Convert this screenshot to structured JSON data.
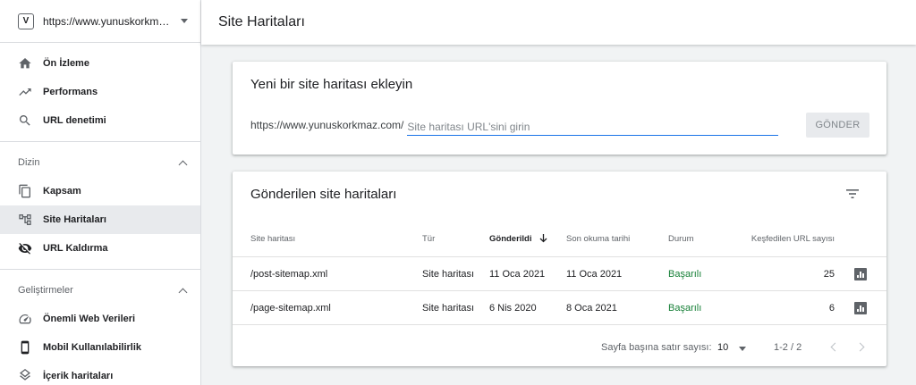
{
  "property": {
    "logo_text": "V",
    "url": "https://www.yunuskorkmaz.c..."
  },
  "header": {
    "title": "Site Haritaları"
  },
  "sidebar": {
    "top_items": [
      {
        "label": "Ön İzleme",
        "icon": "home-icon"
      },
      {
        "label": "Performans",
        "icon": "trending-up-icon"
      },
      {
        "label": "URL denetimi",
        "icon": "search-icon"
      }
    ],
    "groups": [
      {
        "title": "Dizin",
        "items": [
          {
            "label": "Kapsam",
            "icon": "copy-icon"
          },
          {
            "label": "Site Haritaları",
            "icon": "sitemap-icon",
            "active": true
          },
          {
            "label": "URL Kaldırma",
            "icon": "eye-off-icon"
          }
        ]
      },
      {
        "title": "Geliştirmeler",
        "items": [
          {
            "label": "Önemli Web Verileri",
            "icon": "speed-icon"
          },
          {
            "label": "Mobil Kullanılabilirlik",
            "icon": "phone-icon"
          },
          {
            "label": "İçerik haritaları",
            "icon": "layers-icon"
          }
        ]
      }
    ]
  },
  "add_sitemap": {
    "title": "Yeni bir site haritası ekleyin",
    "prefix": "https://www.yunuskorkmaz.com/",
    "placeholder": "Site haritası URL'sini girin",
    "value": "",
    "submit_label": "GÖNDER"
  },
  "submitted": {
    "title": "Gönderilen site haritaları",
    "columns": {
      "map": "Site haritası",
      "type": "Tür",
      "sent": "Gönderildi",
      "read": "Son okuma tarihi",
      "status": "Durum",
      "urls": "Keşfedilen URL sayısı"
    },
    "rows": [
      {
        "map": "/post-sitemap.xml",
        "type": "Site haritası",
        "sent": "11 Oca 2021",
        "read": "11 Oca 2021",
        "status": "Başarılı",
        "urls": "25"
      },
      {
        "map": "/page-sitemap.xml",
        "type": "Site haritası",
        "sent": "6 Nis 2020",
        "read": "8 Oca 2021",
        "status": "Başarılı",
        "urls": "6"
      }
    ],
    "pager": {
      "rows_label": "Sayfa başına satır sayısı:",
      "rows_value": "10",
      "range": "1-2 / 2"
    }
  },
  "colors": {
    "accent": "#1a73e8",
    "success": "#188038"
  }
}
